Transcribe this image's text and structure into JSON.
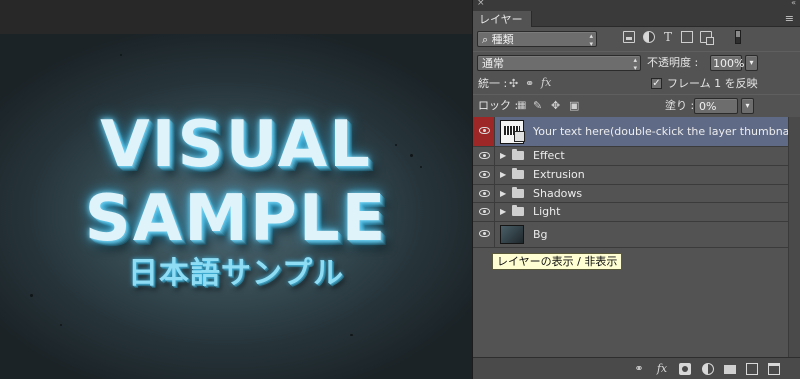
{
  "canvas": {
    "title_line1": "VISUAL",
    "title_line2": "SAMPLE",
    "title_line3": "日本語サンプル"
  },
  "panel": {
    "close_glyph": "×",
    "collapse_glyph": "«",
    "menu_glyph": "≡",
    "tab_label": "レイヤー",
    "filter": {
      "kind_value": "種類",
      "search_glyph": "⌕"
    },
    "blend_mode": "通常",
    "opacity_label": "不透明度 :",
    "opacity_value": "100%",
    "unify_label": "統一 :",
    "fx_label": "fx",
    "propagate_frame_label": "フレーム 1 を反映",
    "propagate_checked": "✓",
    "lock_label": "ロック :",
    "fill_label": "塗り :",
    "fill_value": "0%",
    "layers": [
      {
        "name": "Your text here(double-ckick the layer thumbnail)",
        "type": "smart-object",
        "selected": true
      },
      {
        "name": "Effect",
        "type": "group"
      },
      {
        "name": "Extrusion",
        "type": "group"
      },
      {
        "name": "Shadows",
        "type": "group"
      },
      {
        "name": "Light",
        "type": "group"
      },
      {
        "name": "Bg",
        "type": "image"
      }
    ],
    "tooltip": "レイヤーの表示 / 非表示",
    "bottom_fx": "fx"
  },
  "colors": {
    "panel_bg": "#535353",
    "selected_layer": "#5f6a86",
    "visibility_highlight": "#9d2626",
    "tooltip_bg": "#fffed2"
  },
  "icons": [
    "search-icon",
    "filter-image-icon",
    "filter-adjustment-icon",
    "filter-type-icon",
    "filter-shape-icon",
    "filter-smart-object-icon",
    "eye-icon",
    "folder-icon",
    "link-icon",
    "mask-icon",
    "adjustment-icon",
    "group-icon",
    "new-layer-icon",
    "trash-icon",
    "lock-position-icon",
    "lock-brush-icon",
    "lock-move-icon",
    "lock-all-icon"
  ]
}
